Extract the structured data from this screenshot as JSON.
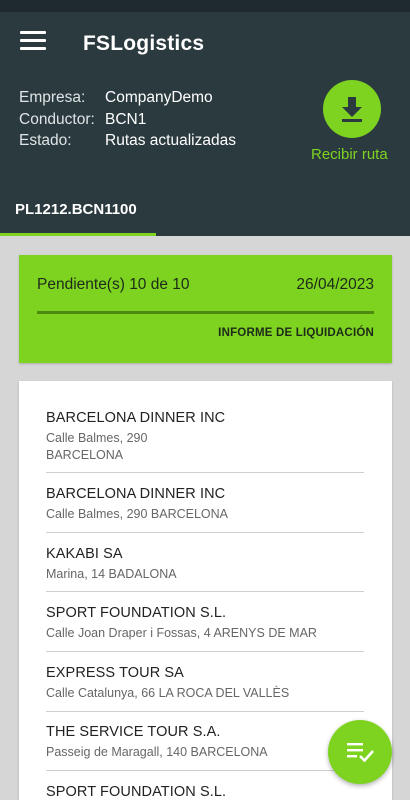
{
  "app": {
    "title": "FSLogistics"
  },
  "info": [
    {
      "label": "Empresa:",
      "value": "CompanyDemo"
    },
    {
      "label": "Conductor:",
      "value": "BCN1"
    },
    {
      "label": "Estado:",
      "value": "Rutas actualizadas"
    }
  ],
  "download": {
    "label": "Recibir ruta"
  },
  "tabs": [
    {
      "label": "PL1212.BCN1100",
      "selected": true
    }
  ],
  "summary": {
    "pending": "Pendiente(s) 10 de 10",
    "date": "26/04/2023",
    "report_button": "INFORME DE LIQUIDACIÓN"
  },
  "customers": [
    {
      "name": "BARCELONA DINNER INC",
      "address": "Calle Balmes, 290\n BARCELONA"
    },
    {
      "name": "BARCELONA DINNER INC",
      "address": "Calle Balmes, 290 BARCELONA"
    },
    {
      "name": "KAKABI SA",
      "address": "Marina, 14 BADALONA"
    },
    {
      "name": "SPORT FOUNDATION S.L.",
      "address": "Calle Joan Draper i Fossas, 4 ARENYS DE MAR"
    },
    {
      "name": "EXPRESS TOUR SA",
      "address": "Calle Catalunya, 66 LA ROCA DEL VALLÈS"
    },
    {
      "name": "THE SERVICE TOUR S.A.",
      "address": "Passeig de Maragall, 140 BARCELONA"
    },
    {
      "name": "SPORT FOUNDATION S.L.",
      "address": ""
    }
  ],
  "colors": {
    "accent": "#7ed321",
    "header": "#2b3a3f",
    "background": "#d6d6d6"
  },
  "icons": {
    "menu": "menu-icon",
    "download": "download-icon",
    "fab": "checklist-icon"
  }
}
